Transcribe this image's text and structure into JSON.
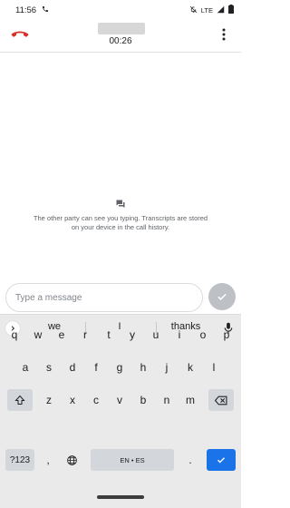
{
  "status_bar": {
    "time": "11:56",
    "network": "LTE"
  },
  "call": {
    "duration": "00:26"
  },
  "transcript_info": "The other party can see you typing. Transcripts are stored on your device in the call history.",
  "composer": {
    "placeholder": "Type a message"
  },
  "keyboard": {
    "suggestions": [
      "we",
      "I",
      "thanks"
    ],
    "rows": [
      [
        "q",
        "w",
        "e",
        "r",
        "t",
        "y",
        "u",
        "i",
        "o",
        "p"
      ],
      [
        "a",
        "s",
        "d",
        "f",
        "g",
        "h",
        "j",
        "k",
        "l"
      ],
      [
        "z",
        "x",
        "c",
        "v",
        "b",
        "n",
        "m"
      ]
    ],
    "symbols_label": "?123",
    "comma_label": ",",
    "period_label": ".",
    "space_label": "EN • ES"
  },
  "colors": {
    "hangup": "#d93025",
    "accent": "#1a73e8",
    "send_disabled": "#bdc1c6"
  }
}
